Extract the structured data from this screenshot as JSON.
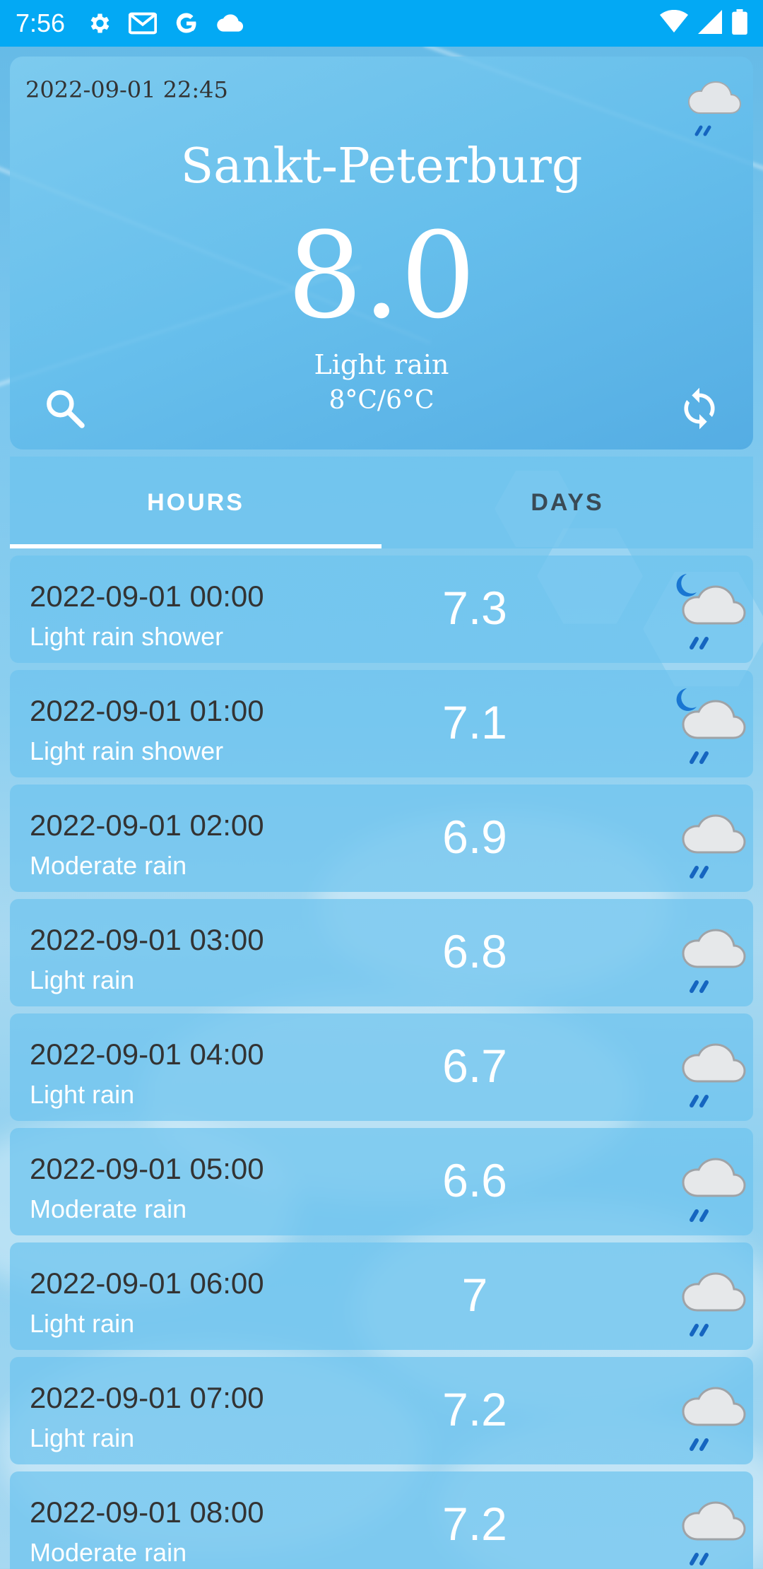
{
  "status_bar": {
    "time": "7:56",
    "icons": [
      "gear-icon",
      "gmail-icon",
      "google-icon",
      "cloud-icon"
    ],
    "right_icons": [
      "wifi-icon",
      "signal-icon",
      "battery-icon"
    ]
  },
  "current": {
    "datetime": "2022-09-01 22:45",
    "city": "Sankt-Peterburg",
    "temperature": "8.0",
    "condition": "Light rain",
    "range": "8°C/6°C",
    "icon": "cloud-rain-icon"
  },
  "tabs": [
    {
      "label": "HOURS",
      "active": true
    },
    {
      "label": "DAYS",
      "active": false
    }
  ],
  "hours": [
    {
      "datetime": "2022-09-01 00:00",
      "condition": "Light rain shower",
      "temp": "7.3",
      "icon": "moon-cloud-rain-icon"
    },
    {
      "datetime": "2022-09-01 01:00",
      "condition": "Light rain shower",
      "temp": "7.1",
      "icon": "moon-cloud-rain-icon"
    },
    {
      "datetime": "2022-09-01 02:00",
      "condition": "Moderate rain",
      "temp": "6.9",
      "icon": "cloud-rain-icon"
    },
    {
      "datetime": "2022-09-01 03:00",
      "condition": "Light rain",
      "temp": "6.8",
      "icon": "cloud-rain-icon"
    },
    {
      "datetime": "2022-09-01 04:00",
      "condition": "Light rain",
      "temp": "6.7",
      "icon": "cloud-rain-icon"
    },
    {
      "datetime": "2022-09-01 05:00",
      "condition": "Moderate rain",
      "temp": "6.6",
      "icon": "cloud-rain-icon"
    },
    {
      "datetime": "2022-09-01 06:00",
      "condition": "Light rain",
      "temp": "7",
      "icon": "cloud-rain-icon"
    },
    {
      "datetime": "2022-09-01 07:00",
      "condition": "Light rain",
      "temp": "7.2",
      "icon": "cloud-rain-icon"
    },
    {
      "datetime": "2022-09-01 08:00",
      "condition": "Moderate rain",
      "temp": "7.2",
      "icon": "cloud-rain-icon"
    }
  ],
  "colors": {
    "status_bar": "#03a9f4",
    "rain_drops": "#1565c0",
    "moon": "#1976d2"
  }
}
